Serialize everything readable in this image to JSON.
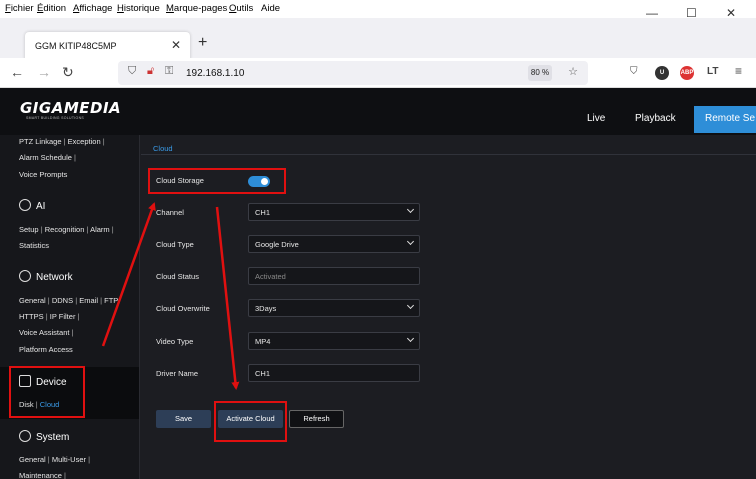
{
  "browser": {
    "menu": [
      {
        "pre": "",
        "u": "F",
        "post": "ichier"
      },
      {
        "pre": "",
        "u": "É",
        "post": "dition"
      },
      {
        "pre": "",
        "u": "A",
        "post": "ffichage"
      },
      {
        "pre": "",
        "u": "H",
        "post": "istorique"
      },
      {
        "pre": "",
        "u": "M",
        "post": "arque-pages"
      },
      {
        "pre": "",
        "u": "O",
        "post": "utils"
      },
      {
        "pre": "",
        "u": "",
        "post": "Aide"
      }
    ],
    "tab_title": "GGM KITIP48C5MP",
    "url": "192.168.1.10",
    "zoom": "80 %"
  },
  "app": {
    "logo": "GIGAMEDIA",
    "logo_tagline": "SMART BUILDING SOLUTIONS",
    "nav": {
      "live": "Live",
      "playback": "Playback",
      "remote": "Remote Se"
    },
    "sidebar": {
      "row1": [
        "PTZ Linkage",
        "Exception"
      ],
      "row2": [
        "Alarm Schedule"
      ],
      "row3": [
        "Voice Prompts"
      ],
      "ai": {
        "title": "AI",
        "row1": [
          "Setup",
          "Recognition",
          "Alarm"
        ],
        "row2": [
          "Statistics"
        ]
      },
      "network": {
        "title": "Network",
        "row1": [
          "General",
          "DDNS",
          "Email",
          "FTP"
        ],
        "row2": [
          "HTTPS",
          "IP Filter"
        ],
        "row3": [
          "Voice Assistant"
        ],
        "row4": [
          "Platform Access"
        ]
      },
      "device": {
        "title": "Device",
        "items": [
          "Disk",
          "Cloud"
        ]
      },
      "system": {
        "title": "System",
        "row1": [
          "General",
          "Multi-User"
        ],
        "row2": [
          "Maintenance"
        ]
      }
    },
    "content": {
      "tab": "Cloud",
      "cloud_storage": {
        "label": "Cloud Storage",
        "enabled": true
      },
      "fields": [
        {
          "label": "Channel",
          "value": "CH1",
          "type": "select"
        },
        {
          "label": "Cloud Type",
          "value": "Google Drive",
          "type": "select"
        },
        {
          "label": "Cloud Status",
          "value": "Activated",
          "type": "readonly"
        },
        {
          "label": "Cloud Overwrite",
          "value": "3Days",
          "type": "select"
        },
        {
          "label": "Video Type",
          "value": "MP4",
          "type": "select"
        },
        {
          "label": "Driver Name",
          "value": "CH1",
          "type": "input"
        }
      ],
      "buttons": {
        "save": "Save",
        "activate": "Activate Cloud",
        "refresh": "Refresh"
      }
    }
  },
  "colors": {
    "accent": "#2e8ed8",
    "annotation": "#e01010"
  }
}
